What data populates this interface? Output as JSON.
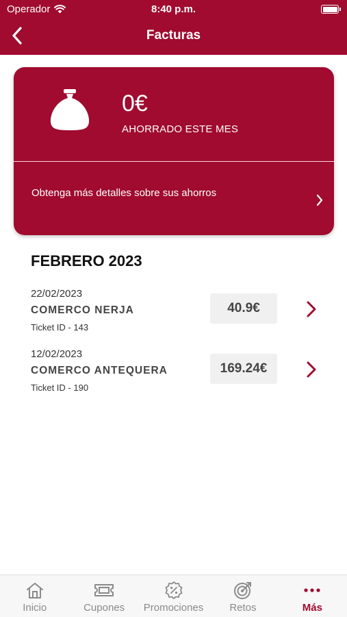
{
  "status_bar": {
    "carrier": "Operador",
    "time": "8:40 p.m."
  },
  "header": {
    "title": "Facturas"
  },
  "savings_card": {
    "amount": "0€",
    "label": "AHORRADO ESTE MES",
    "details_text": "Obtenga más detalles sobre sus ahorros",
    "icon": "money-bag-icon"
  },
  "month_heading": "FEBRERO 2023",
  "invoices": [
    {
      "date": "22/02/2023",
      "store": "COMERCO NERJA",
      "ticket": "Ticket ID - 143",
      "amount": "40.9€"
    },
    {
      "date": "12/02/2023",
      "store": "COMERCO ANTEQUERA",
      "ticket": "Ticket ID - 190",
      "amount": "169.24€"
    }
  ],
  "tabbar": {
    "items": [
      {
        "label": "Inicio",
        "icon": "home-icon"
      },
      {
        "label": "Cupones",
        "icon": "ticket-icon"
      },
      {
        "label": "Promociones",
        "icon": "percent-badge-icon"
      },
      {
        "label": "Retos",
        "icon": "target-icon"
      },
      {
        "label": "Más",
        "icon": "more-dots-icon"
      }
    ],
    "active": "Más"
  },
  "colors": {
    "brand": "#a00b2f",
    "tab_inactive": "#8a8a8a",
    "price_bg": "#f0f0f0"
  }
}
